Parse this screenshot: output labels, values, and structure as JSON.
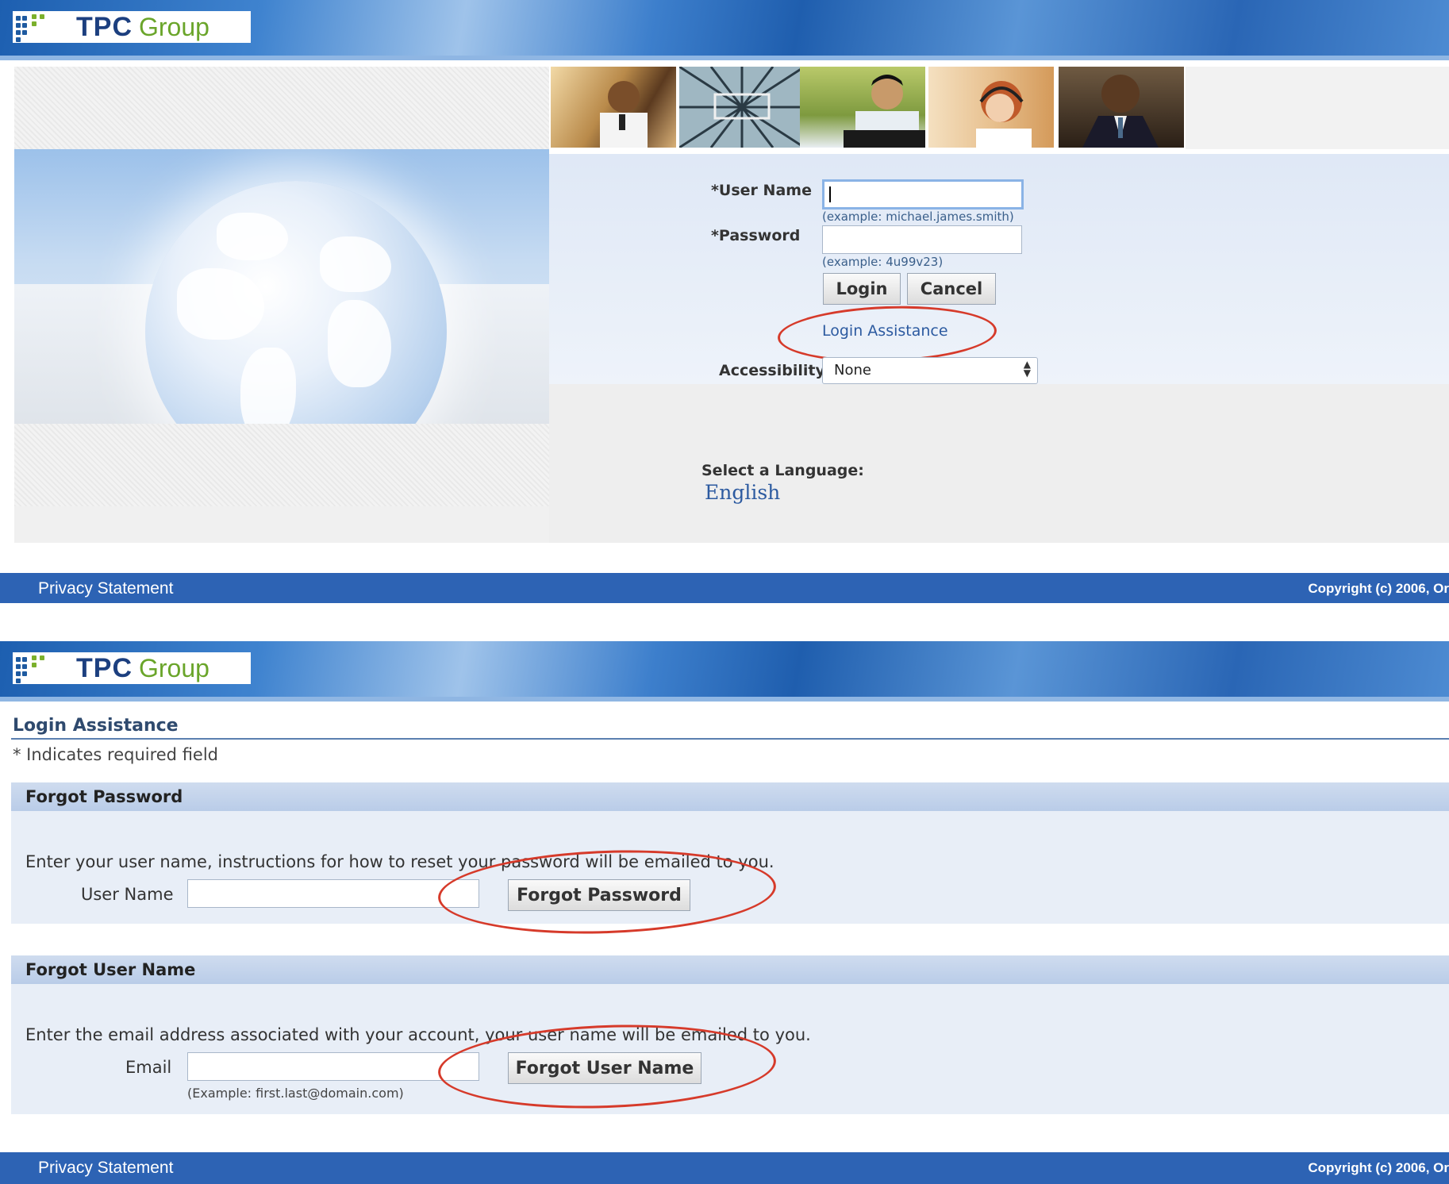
{
  "brand": {
    "logo_primary": "TPC",
    "logo_secondary": "Group"
  },
  "login_page": {
    "username_label": "*User Name",
    "username_hint": "(example: michael.james.smith)",
    "password_label": "*Password",
    "password_hint": "(example: 4u99v23)",
    "login_button": "Login",
    "cancel_button": "Cancel",
    "assistance_link": "Login Assistance",
    "accessibility_label": "Accessibility",
    "accessibility_value": "None",
    "language_label": "Select a Language:",
    "language_value": "English"
  },
  "assistance_page": {
    "title": "Login Assistance",
    "required_note": "* Indicates required field",
    "forgot_password": {
      "heading": "Forgot Password",
      "instructions": "Enter your user name, instructions for how to reset your password will be emailed to you.",
      "field_label": "User Name",
      "button": "Forgot Password"
    },
    "forgot_username": {
      "heading": "Forgot User Name",
      "instructions": "Enter the email address associated with your account, your user name will be emailed to you.",
      "field_label": "Email",
      "field_hint": "(Example: first.last@domain.com)",
      "button": "Forgot User Name"
    }
  },
  "footer": {
    "privacy": "Privacy Statement",
    "copyright": "Copyright (c) 2006, Or"
  },
  "colors": {
    "header_blue": "#2d63b4",
    "annotation_red": "#d63a2a",
    "link_blue": "#2c5aa0",
    "logo_green": "#6aa52a"
  }
}
